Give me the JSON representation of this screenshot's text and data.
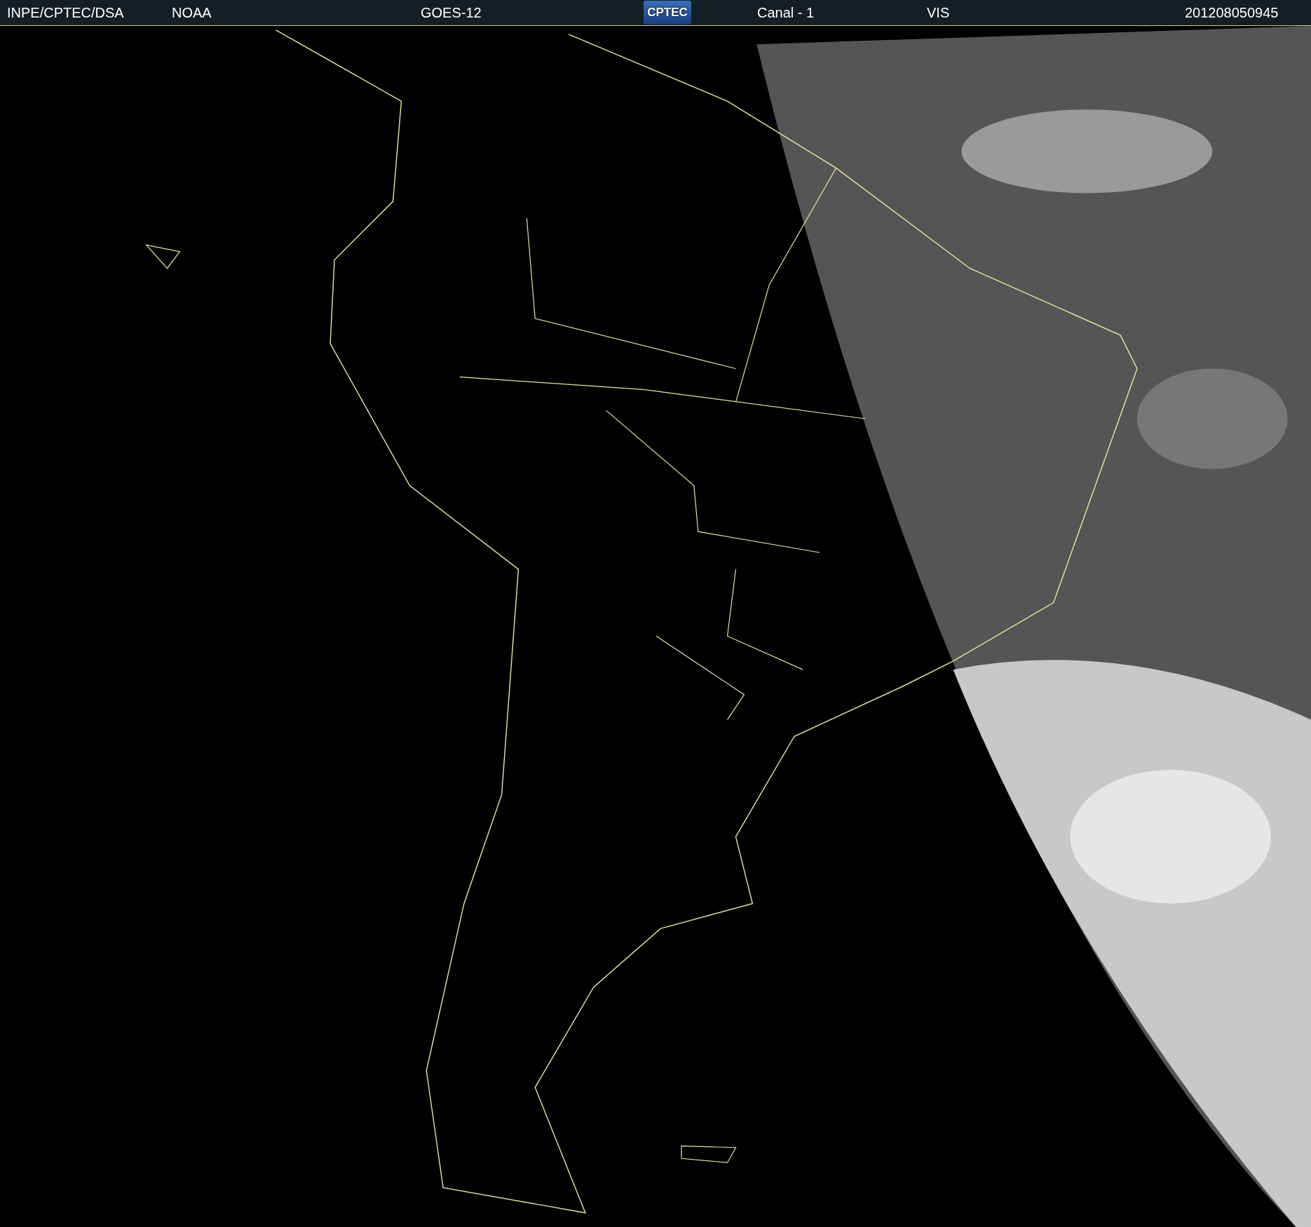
{
  "header": {
    "items": [
      {
        "kind": "text",
        "text": "INPE/CPTEC/DSA"
      },
      {
        "kind": "text",
        "text": "NOAA"
      },
      {
        "kind": "text",
        "text": "GOES-12"
      },
      {
        "kind": "logo",
        "text": "CPTEC"
      },
      {
        "kind": "text",
        "text": "Canal - 1"
      },
      {
        "kind": "text",
        "text": "VIS"
      },
      {
        "kind": "text",
        "text": "201208050945"
      }
    ]
  }
}
